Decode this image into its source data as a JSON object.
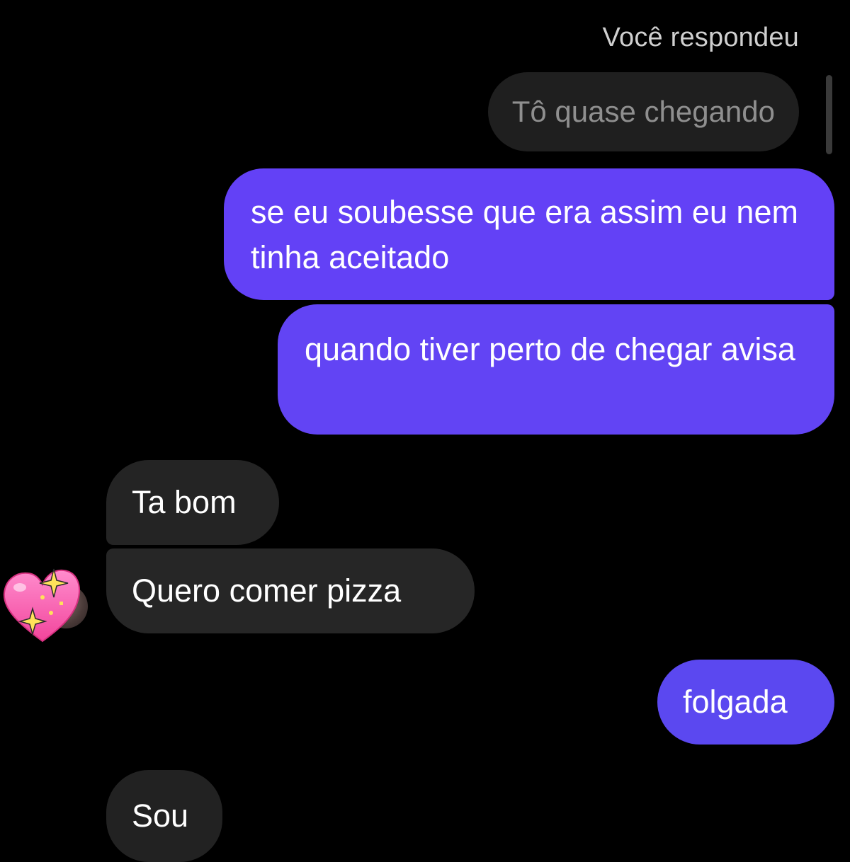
{
  "thread": {
    "reply_label": "Você respondeu",
    "quoted_text": "Tô quase chegando"
  },
  "messages": [
    {
      "direction": "sent",
      "text": "se eu soubesse que era assim eu nem tinha aceitado"
    },
    {
      "direction": "sent",
      "text": "quando tiver perto de chegar avisa"
    },
    {
      "direction": "received",
      "text": "Ta bom"
    },
    {
      "direction": "received",
      "text": "Quero comer pizza"
    },
    {
      "direction": "sent",
      "text": "folgada"
    },
    {
      "direction": "received",
      "text": "Sou"
    }
  ],
  "reactions": {
    "pizza_message": "sparkling-heart-icon"
  },
  "colors": {
    "background": "#000000",
    "sent_bubble": "#6341f6",
    "received_bubble": "#262626",
    "quoted_text": "#8f8f8f",
    "reply_label": "#cfcfcf"
  }
}
